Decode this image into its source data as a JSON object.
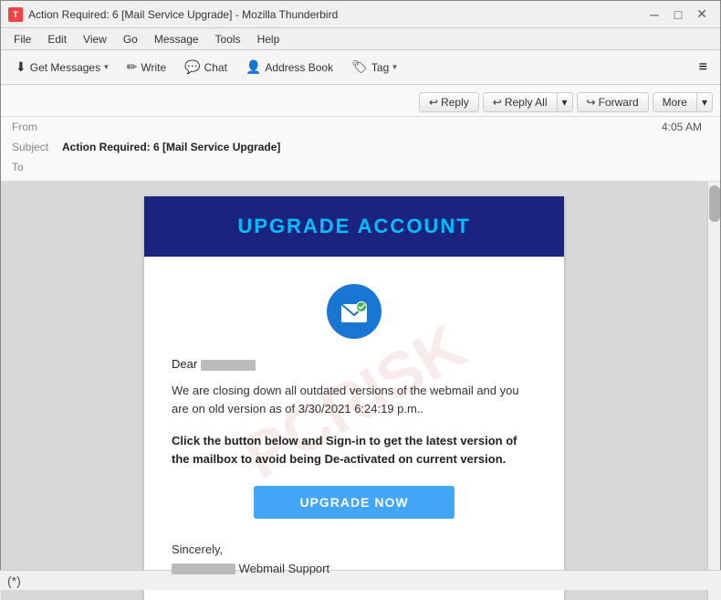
{
  "window": {
    "title": "Action Required: 6 [Mail Service Upgrade] - Mozilla Thunderbird",
    "app_name": "Mozilla Thunderbird"
  },
  "titlebar": {
    "minimize": "─",
    "maximize": "□",
    "close": "✕"
  },
  "menubar": {
    "items": [
      "File",
      "Edit",
      "View",
      "Go",
      "Message",
      "Tools",
      "Help"
    ]
  },
  "toolbar": {
    "get_messages": "Get Messages",
    "write": "Write",
    "chat": "Chat",
    "address_book": "Address Book",
    "tag": "Tag",
    "hamburger": "≡"
  },
  "email_header": {
    "from_label": "From",
    "subject_label": "Subject",
    "to_label": "To",
    "subject_value": "Action Required: 6 [Mail Service Upgrade]",
    "time": "4:05 AM"
  },
  "action_buttons": {
    "reply": "Reply",
    "reply_all": "Reply All",
    "reply_all_dropdown": "▾",
    "forward": "Forward",
    "more": "More",
    "more_dropdown": "▾"
  },
  "email_content": {
    "banner_text": "UPGRADE ACCOUNT",
    "greeting": "Dear",
    "body_text": "We are closing down all outdated versions of the webmail and you are on old version as of 3/30/2021 6:24:19 p.m..",
    "cta_text": "Click the button below and Sign-in to get the latest version of the mailbox to avoid being De-activated on current version.",
    "cta_button": "UPGRADE NOW",
    "signature_line1": "Sincerely,",
    "signature_line2": "Webmail Support"
  },
  "watermark": {
    "text": "PCRISK"
  },
  "status_bar": {
    "icon": "(*)"
  }
}
